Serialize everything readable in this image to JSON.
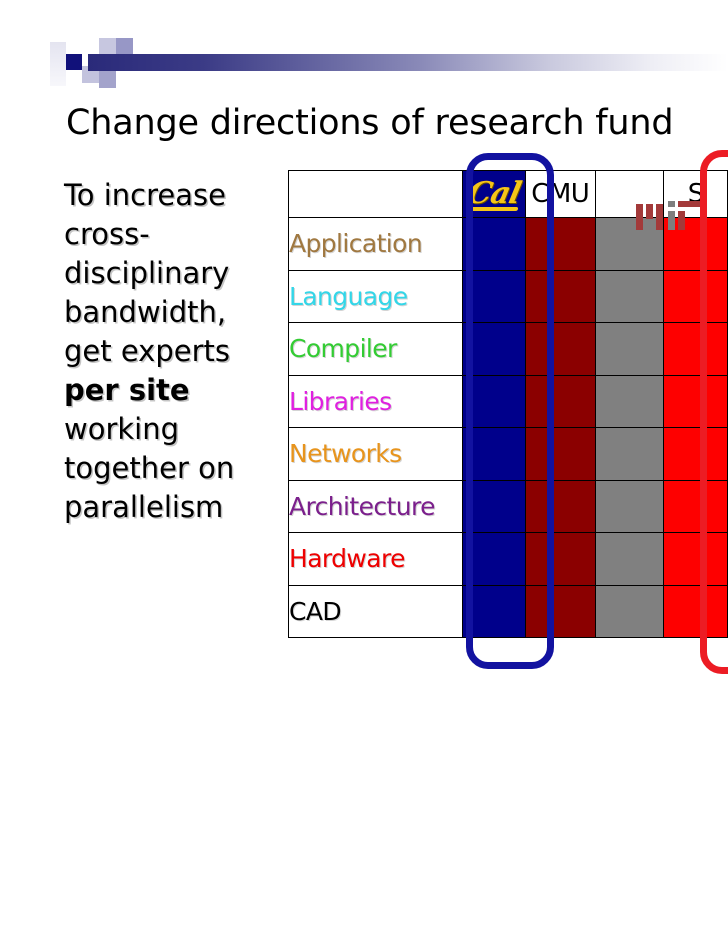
{
  "slide": {
    "title": "Change directions of research fund",
    "body_text_before_bold": "To increase cross-disciplinary bandwidth, get experts ",
    "body_bold": "per site",
    "body_text_after_bold": " working together on parallelism"
  },
  "decoration": {
    "name": "powerpoint-header-bar",
    "gradient_from": "#2a2a7a",
    "gradient_to": "#ffffff",
    "accent_square": "#11117a"
  },
  "table": {
    "columns": [
      {
        "key": "label",
        "label": "",
        "kind": "label"
      },
      {
        "key": "cal",
        "label": "Cal",
        "kind": "logo-cal",
        "fill": "#00008b",
        "highlighted": true,
        "highlight_color": "#1212a0"
      },
      {
        "key": "cmu",
        "label": "CMU",
        "kind": "text",
        "fill": "#8b0000",
        "highlighted": false,
        "highlight_color": ""
      },
      {
        "key": "mit",
        "label": "MIT",
        "kind": "logo-mit",
        "fill": "#808080",
        "highlighted": false,
        "highlight_color": ""
      },
      {
        "key": "s",
        "label": "S",
        "kind": "text",
        "fill": "#fe0000",
        "highlighted": true,
        "highlight_color": "#ec1c24"
      }
    ],
    "rows": [
      {
        "label": "Application",
        "color": "#a07840"
      },
      {
        "label": "Language",
        "color": "#33d6e8"
      },
      {
        "label": "Compiler",
        "color": "#33cc33"
      },
      {
        "label": "Libraries",
        "color": "#e020e0"
      },
      {
        "label": "Networks",
        "color": "#e8941c"
      },
      {
        "label": "Architecture",
        "color": "#7b1f8c"
      },
      {
        "label": "Hardware",
        "color": "#ee0000"
      },
      {
        "label": "CAD",
        "color": "#000000"
      }
    ]
  }
}
